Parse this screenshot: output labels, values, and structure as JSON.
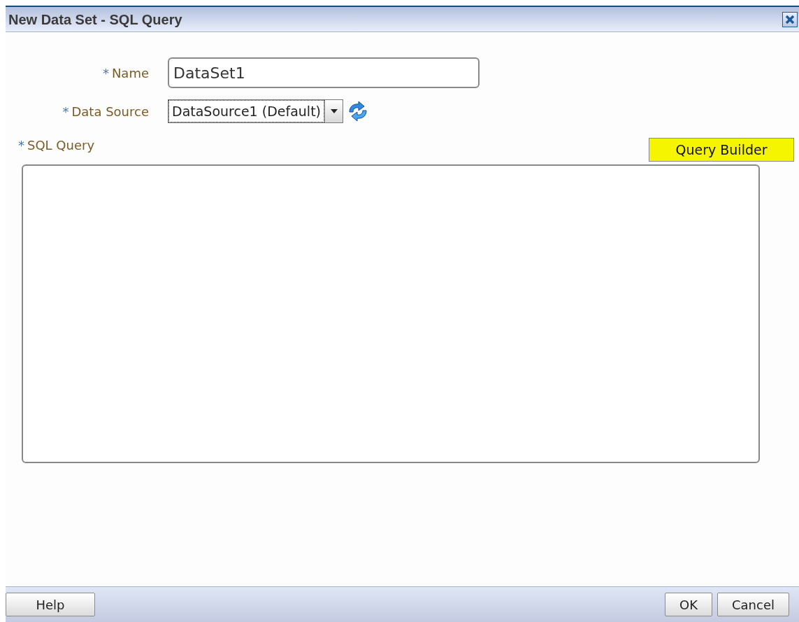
{
  "dialog": {
    "title": "New Data Set - SQL Query"
  },
  "fields": [
    {
      "kind": "text",
      "mark": "*",
      "label": "Name",
      "value": "DataSet1"
    },
    {
      "kind": "select",
      "mark": "*",
      "label": "Data Source",
      "value": "DataSource1 (Default)"
    }
  ],
  "query": {
    "mark": "*",
    "label": "SQL Query",
    "builder_button": "Query Builder"
  },
  "footer": {
    "left_buttons": [
      "Help"
    ],
    "right_buttons": [
      "OK",
      "Cancel"
    ]
  }
}
